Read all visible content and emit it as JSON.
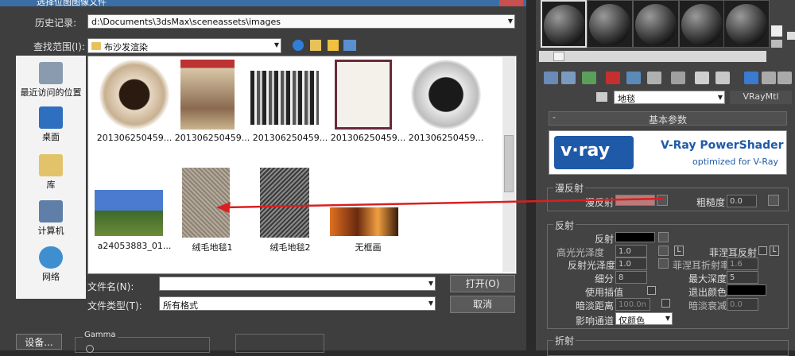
{
  "dialog": {
    "title": "选择位图图像文件",
    "history_label": "历史记录:",
    "history_value": "d:\\Documents\\3dsMax\\sceneassets\\images",
    "lookin_label": "查找范围(I):",
    "lookin_value": "布沙发渲染",
    "places": [
      "最近访问的位置",
      "桌面",
      "库",
      "计算机",
      "网络"
    ],
    "files": [
      "201306250459...",
      "201306250459...",
      "201306250459...",
      "201306250459...",
      "201306250459...",
      "a24053883_01...",
      "绒毛地毯1",
      "绒毛地毯2",
      "无框画"
    ],
    "filename_label": "文件名(N):",
    "filename_value": "",
    "filetype_label": "文件类型(T):",
    "filetype_value": "所有格式",
    "open_button": "打开(O)",
    "cancel_button": "取消",
    "setup_button": "设备...",
    "gamma_label": "Gamma"
  },
  "material": {
    "name": "地毯",
    "type": "VRayMtl",
    "rollout": "基本参数",
    "banner_brand": "v·ray",
    "banner_title": "V-Ray PowerShader",
    "banner_sub": "optimized for V-Ray",
    "diffuse_group": "漫反射",
    "diffuse_label": "漫反射",
    "roughness_label": "粗糙度",
    "roughness_value": "0.0",
    "reflection_group": "反射",
    "reflect_label": "反射",
    "hilight_label": "高光光泽度",
    "hilight_value": "1.0",
    "L": "L",
    "fresnel_label": "菲涅耳反射",
    "refl_gloss_label": "反射光泽度",
    "refl_gloss_value": "1.0",
    "fresnel_ior_label": "菲涅耳折射率",
    "fresnel_ior_value": "1.6",
    "subdivs_label": "细分",
    "subdivs_value": "8",
    "maxdepth_label": "最大深度",
    "maxdepth_value": "5",
    "interp_label": "使用插值",
    "exit_label": "退出颜色",
    "dim_dist_label": "暗淡距离",
    "dim_dist_value": "100.0n",
    "dim_falloff_label": "暗淡衰减",
    "dim_falloff_value": "0.0",
    "affect_label": "影响通道",
    "affect_value": "仅颜色",
    "refraction_group": "折射"
  },
  "colors": {
    "arrow": "#d92020",
    "accent": "#3a6ea5"
  }
}
